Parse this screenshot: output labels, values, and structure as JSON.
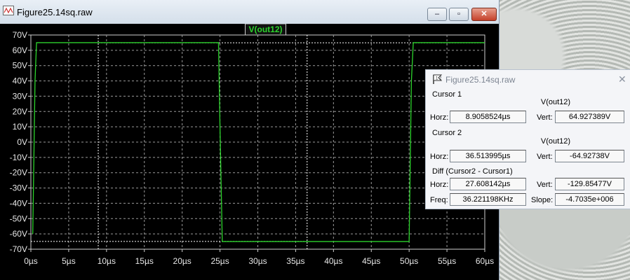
{
  "window": {
    "title": "Figure25.14sq.raw",
    "min_glyph": "–",
    "max_glyph": "▫",
    "close_glyph": "✕"
  },
  "plot": {
    "trace_label": "V(out12)",
    "trace_color": "#2cd32c",
    "background": "#000000"
  },
  "chart_data": {
    "type": "line",
    "title": "V(out12)",
    "xlabel": "",
    "ylabel": "",
    "xlim": [
      0,
      60
    ],
    "ylim": [
      -70,
      70
    ],
    "x_ticks": [
      "0µs",
      "5µs",
      "10µs",
      "15µs",
      "20µs",
      "25µs",
      "30µs",
      "35µs",
      "40µs",
      "45µs",
      "50µs",
      "55µs",
      "60µs"
    ],
    "y_ticks": [
      "70V",
      "60V",
      "50V",
      "40V",
      "30V",
      "20V",
      "10V",
      "0V",
      "-10V",
      "-20V",
      "-30V",
      "-40V",
      "-50V",
      "-60V",
      "-70V"
    ],
    "grid": true,
    "series": [
      {
        "name": "V(out12)",
        "x": [
          0.25,
          0.55,
          0.75,
          24.8,
          25.0,
          25.3,
          50.0,
          50.3,
          50.55,
          60
        ],
        "y": [
          -60,
          40,
          65,
          65,
          10,
          -65,
          -65,
          40,
          65,
          65
        ]
      }
    ],
    "cursors": {
      "cursor1_x": 8.9058524,
      "cursor2_x": 36.513995,
      "cursor1_y": 64.927389,
      "cursor2_y": -64.92738
    }
  },
  "dialog": {
    "title": "Figure25.14sq.raw",
    "close_glyph": "✕",
    "cursor1": {
      "heading": "Cursor 1",
      "trace": "V(out12)",
      "horz_label": "Horz:",
      "horz": "8.9058524µs",
      "vert_label": "Vert:",
      "vert": "64.927389V"
    },
    "cursor2": {
      "heading": "Cursor 2",
      "trace": "V(out12)",
      "horz_label": "Horz:",
      "horz": "36.513995µs",
      "vert_label": "Vert:",
      "vert": "-64.92738V"
    },
    "diff": {
      "heading": "Diff (Cursor2 - Cursor1)",
      "horz_label": "Horz:",
      "horz": "27.608142µs",
      "vert_label": "Vert:",
      "vert": "-129.85477V",
      "freq_label": "Freq:",
      "freq": "36.221198KHz",
      "slope_label": "Slope:",
      "slope": "-4.7035e+006"
    }
  }
}
